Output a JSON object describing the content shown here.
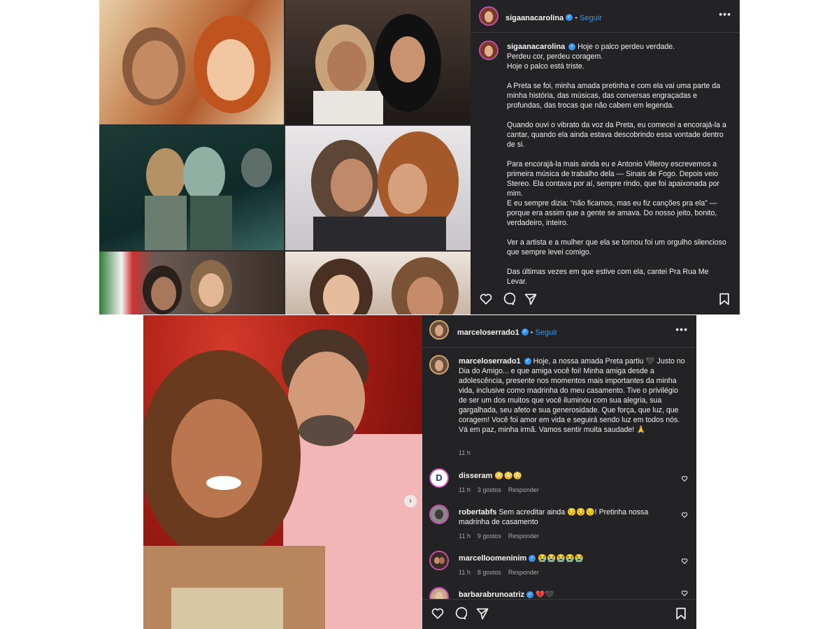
{
  "post1": {
    "username": "sigaanacarolina",
    "follow_label": "Seguir",
    "separator": "•",
    "more_label": "•••",
    "caption_username": "sigaanacarolina",
    "caption": "Hoje o palco perdeu verdade.\nPerdeu cor, perdeu coragem.\nHoje o palco está triste.\n\nA Preta se foi, minha amada pretinha e com ela vai uma parte da minha história, das músicas, das conversas engraçadas e profundas, das trocas que não cabem em legenda.\n\nQuando ouvi o vibrato da voz da Preta, eu comecei a encorajá-la a cantar, quando ela ainda estava descobrindo essa vontade dentro de si.\n\nPara encorajá-la mais ainda eu e Antonio Villeroy escrevemos a primeira música de trabalho dela — Sinais de Fogo. Depois veio Stereo. Ela contava por aí, sempre rindo, que foi apaixonada por mim.\nE eu sempre dizia: “não ficamos, mas eu fiz canções pra ela” — porque era assim que a gente se amava. Do nosso jeito, bonito, verdadeiro, inteiro.\n\nVer a artista e a mulher que ela se tornou foi um orgulho silencioso que sempre levei comigo.\n\nDas últimas vezes em que estive com ela, cantei Pra Rua Me Levar."
  },
  "post2": {
    "username": "marceloserrado1",
    "follow_label": "Seguir",
    "separator": "•",
    "more_label": "•••",
    "caption_username": "marceloserrado1",
    "caption": "Hoje, a nossa amada Preta partiu 🖤 Justo no Dia do Amigo... e que amiga você foi! Minha amiga desde a adolescência, presente nos momentos mais importantes da minha vida, inclusive como madrinha do meu casamento. Tive o privilégio de ser um dos muitos que você iluminou com sua alegria, sua gargalhada, seu afeto e sua generosidade. Que força, que luz, que coragem! Você foi amor em vida e seguirá sendo luz em todos nós. Vá em paz, minha irmã. Vamos sentir muita saudade! 🙏",
    "caption_time": "11 h",
    "reply_label": "Responder",
    "comments": [
      {
        "username": "disseram",
        "text": "😳😳😳",
        "time": "11 h",
        "likes": "3 gostos",
        "avatar": "D"
      },
      {
        "username": "robertabfs",
        "text": "Sem acreditar ainda 😔😔😔! Pretinha nossa madrinha de casamento",
        "time": "11 h",
        "likes": "9 gostos"
      },
      {
        "username": "marcelloomeninim",
        "text": "😭😭😭😭😭",
        "time": "11 h",
        "likes": "8 gostos"
      },
      {
        "username": "barbarabrunoatriz",
        "text": "💔🖤"
      }
    ]
  },
  "icons": [
    "heart-icon",
    "comment-icon",
    "share-icon",
    "bookmark-icon",
    "verified-icon",
    "more-icon",
    "chevron-right-icon"
  ],
  "colors": {
    "panel_bg": "#232326",
    "accent": "#3797f0",
    "text": "#f5f5f5",
    "muted": "#a8a8a8"
  }
}
